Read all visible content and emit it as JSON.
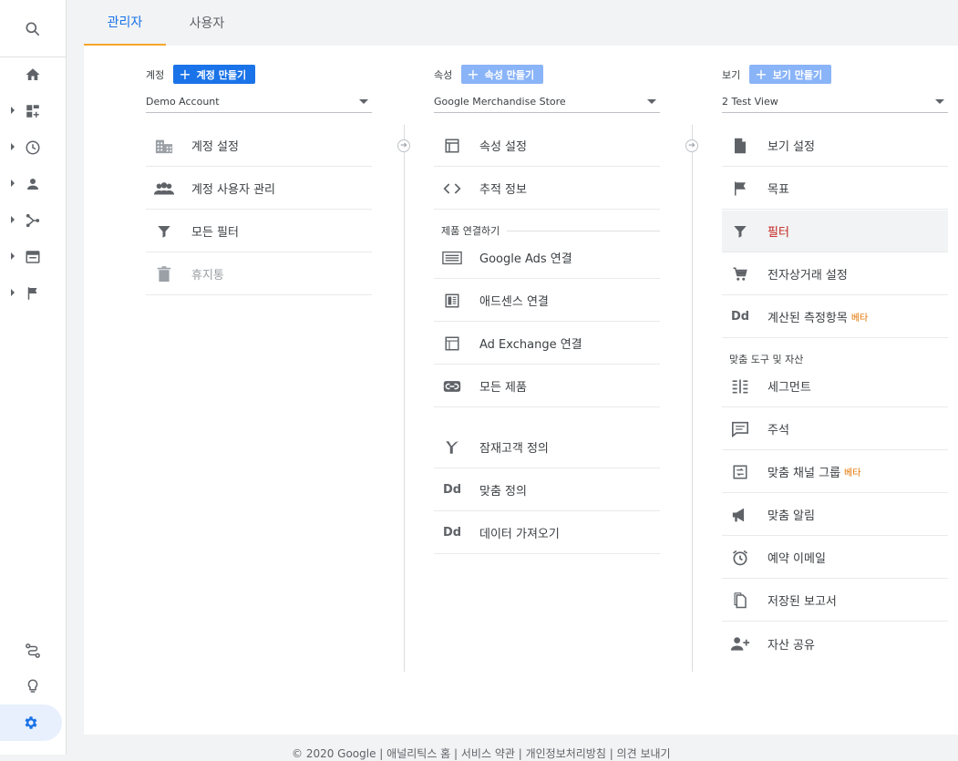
{
  "tabs": {
    "admin": "관리자",
    "user": "사용자"
  },
  "account": {
    "heading": "계정",
    "create_label": "계정 만들기",
    "selected": "Demo Account",
    "items": [
      {
        "label": "계정 설정"
      },
      {
        "label": "계정 사용자 관리"
      },
      {
        "label": "모든 필터"
      },
      {
        "label": "휴지통"
      }
    ]
  },
  "property": {
    "heading": "속성",
    "create_label": "속성 만들기",
    "selected": "Google Merchandise Store",
    "items": [
      {
        "label": "속성 설정"
      },
      {
        "label": "추적 정보"
      }
    ],
    "section_label": "제품 연결하기",
    "linking": [
      {
        "label": "Google Ads 연결"
      },
      {
        "label": "애드센스 연결"
      },
      {
        "label": "Ad Exchange 연결"
      },
      {
        "label": "모든 제품"
      }
    ],
    "extra": [
      {
        "label": "잠재고객 정의"
      },
      {
        "label": "맞춤 정의"
      },
      {
        "label": "데이터 가져오기"
      }
    ]
  },
  "view": {
    "heading": "보기",
    "create_label": "보기 만들기",
    "selected": "2 Test View",
    "items": [
      {
        "label": "보기 설정"
      },
      {
        "label": "목표"
      },
      {
        "label": "필터"
      },
      {
        "label": "전자상거래 설정"
      },
      {
        "label": "계산된 측정항목",
        "badge": "베타"
      }
    ],
    "section_label": "맞춤 도구 및 자산",
    "tools": [
      {
        "label": "세그먼트"
      },
      {
        "label": "주석"
      },
      {
        "label": "맞춤 채널 그룹",
        "badge": "베타"
      },
      {
        "label": "맞춤 알림"
      },
      {
        "label": "예약 이메일"
      },
      {
        "label": "저장된 보고서"
      },
      {
        "label": "자산 공유"
      }
    ]
  },
  "footer": {
    "text": "© 2020 Google | 애널리틱스 홈 | 서비스 약관 | 개인정보처리방침 | 의견 보내기"
  },
  "colors": {
    "accent": "#1a73e8",
    "tab_underline": "#f4a62a",
    "beta": "#e37400",
    "active_filter": "#c5221f"
  }
}
